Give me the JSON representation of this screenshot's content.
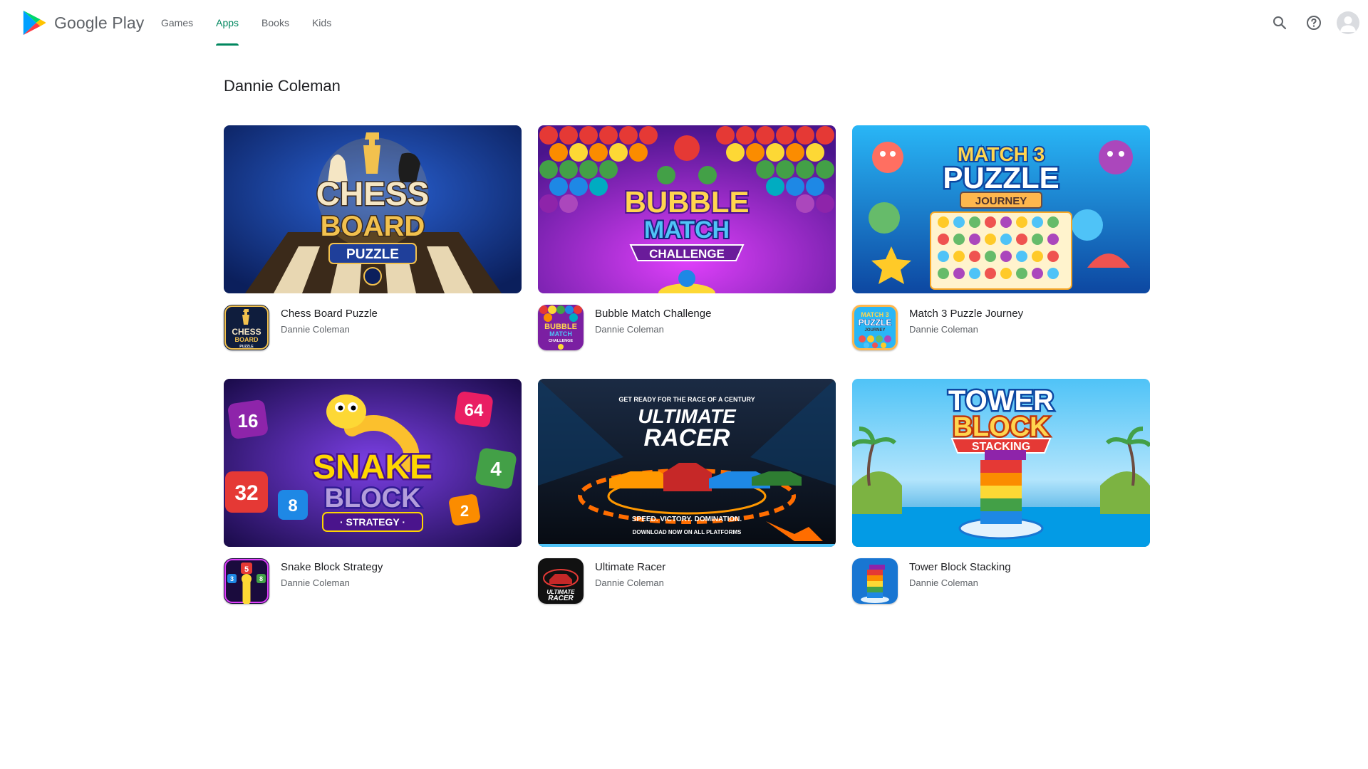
{
  "header": {
    "brand": "Google Play",
    "tabs": [
      {
        "label": "Games",
        "active": false
      },
      {
        "label": "Apps",
        "active": true
      },
      {
        "label": "Books",
        "active": false
      },
      {
        "label": "Kids",
        "active": false
      }
    ],
    "icons": [
      "search-icon",
      "help-icon",
      "account-avatar"
    ],
    "accent_color": "#01875f"
  },
  "main": {
    "title": "Dannie Coleman",
    "apps": [
      {
        "name": "Chess Board Puzzle",
        "developer": "Dannie Coleman",
        "banner": {
          "line1": "CHESS",
          "line2": "BOARD",
          "line3": "PUZZLE",
          "bg": "#14307a",
          "accent": "#f2c14e"
        },
        "icon": {
          "line1": "CHESS",
          "line2": "BOARD",
          "line3": "PUZZLE",
          "bg": "#0f1d3d"
        }
      },
      {
        "name": "Bubble Match Challenge",
        "developer": "Dannie Coleman",
        "banner": {
          "line1": "BUBBLE",
          "line2": "MATCH",
          "line3": "CHALLENGE",
          "bg": "#6a1b9a",
          "accent": "#ffd54f"
        },
        "icon": {
          "line1": "BUBBLE",
          "line2": "MATCH",
          "line3": "CHALLENGE",
          "bg": "#7b1fa2"
        }
      },
      {
        "name": "Match 3 Puzzle Journey",
        "developer": "Dannie Coleman",
        "banner": {
          "line1": "MATCH 3",
          "line2": "PUZZLE",
          "line3": "JOURNEY",
          "bg": "#1e88c8",
          "accent": "#ffd54f"
        },
        "icon": {
          "line1": "MATCH 3",
          "line2": "PUZZLE",
          "line3": "JOURNEY",
          "bg": "#ffb74d"
        }
      },
      {
        "name": "Snake Block Strategy",
        "developer": "Dannie Coleman",
        "banner": {
          "line1": "SNAKE",
          "line2": "BLOCK",
          "line3": "· STRATEGY ·",
          "bg": "#3a0f7a",
          "accent": "#ffd600",
          "tiles": [
            "16",
            "64",
            "32",
            "8",
            "4",
            "2"
          ]
        },
        "icon": {
          "tiles": [
            "5",
            "3",
            "8"
          ],
          "bg": "#1a0b3d"
        }
      },
      {
        "name": "Ultimate Racer",
        "developer": "Dannie Coleman",
        "banner": {
          "line0": "GET READY FOR THE RACE OF A CENTURY",
          "line1": "ULTIMATE",
          "line2": "RACER",
          "line3": "SPEED. VICTORY. DOMINATION.",
          "line4": "DOWNLOAD NOW ON ALL PLATFORMS",
          "bg": "#0e1a2b",
          "accent": "#ff6d00"
        },
        "icon": {
          "line1": "ULTIMATE",
          "line2": "RACER",
          "bg": "#111111"
        }
      },
      {
        "name": "Tower Block Stacking",
        "developer": "Dannie Coleman",
        "banner": {
          "line1": "TOWER",
          "line2": "BLOCK",
          "line3": "STACKING",
          "bg": "#4fc3f7",
          "accent": "#ffffff"
        },
        "icon": {
          "bg": "#1976d2"
        }
      }
    ]
  }
}
